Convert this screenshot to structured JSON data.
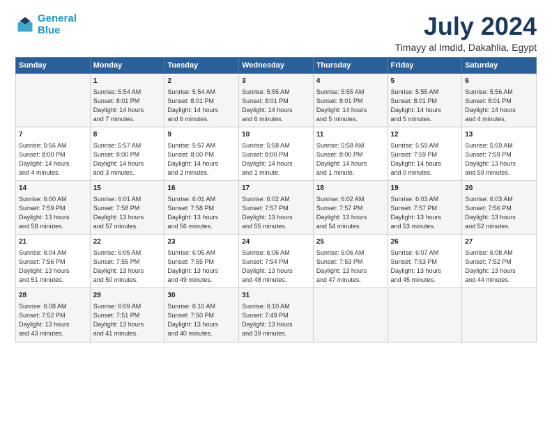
{
  "header": {
    "logo_line1": "General",
    "logo_line2": "Blue",
    "title": "July 2024",
    "subtitle": "Timayy al Imdid, Dakahlia, Egypt"
  },
  "days_of_week": [
    "Sunday",
    "Monday",
    "Tuesday",
    "Wednesday",
    "Thursday",
    "Friday",
    "Saturday"
  ],
  "weeks": [
    [
      {
        "day": "",
        "content": ""
      },
      {
        "day": "1",
        "content": "Sunrise: 5:54 AM\nSunset: 8:01 PM\nDaylight: 14 hours\nand 7 minutes."
      },
      {
        "day": "2",
        "content": "Sunrise: 5:54 AM\nSunset: 8:01 PM\nDaylight: 14 hours\nand 6 minutes."
      },
      {
        "day": "3",
        "content": "Sunrise: 5:55 AM\nSunset: 8:01 PM\nDaylight: 14 hours\nand 6 minutes."
      },
      {
        "day": "4",
        "content": "Sunrise: 5:55 AM\nSunset: 8:01 PM\nDaylight: 14 hours\nand 5 minutes."
      },
      {
        "day": "5",
        "content": "Sunrise: 5:55 AM\nSunset: 8:01 PM\nDaylight: 14 hours\nand 5 minutes."
      },
      {
        "day": "6",
        "content": "Sunrise: 5:56 AM\nSunset: 8:01 PM\nDaylight: 14 hours\nand 4 minutes."
      }
    ],
    [
      {
        "day": "7",
        "content": "Sunrise: 5:56 AM\nSunset: 8:00 PM\nDaylight: 14 hours\nand 4 minutes."
      },
      {
        "day": "8",
        "content": "Sunrise: 5:57 AM\nSunset: 8:00 PM\nDaylight: 14 hours\nand 3 minutes."
      },
      {
        "day": "9",
        "content": "Sunrise: 5:57 AM\nSunset: 8:00 PM\nDaylight: 14 hours\nand 2 minutes."
      },
      {
        "day": "10",
        "content": "Sunrise: 5:58 AM\nSunset: 8:00 PM\nDaylight: 14 hours\nand 1 minute."
      },
      {
        "day": "11",
        "content": "Sunrise: 5:58 AM\nSunset: 8:00 PM\nDaylight: 14 hours\nand 1 minute."
      },
      {
        "day": "12",
        "content": "Sunrise: 5:59 AM\nSunset: 7:59 PM\nDaylight: 14 hours\nand 0 minutes."
      },
      {
        "day": "13",
        "content": "Sunrise: 5:59 AM\nSunset: 7:59 PM\nDaylight: 13 hours\nand 59 minutes."
      }
    ],
    [
      {
        "day": "14",
        "content": "Sunrise: 6:00 AM\nSunset: 7:59 PM\nDaylight: 13 hours\nand 58 minutes."
      },
      {
        "day": "15",
        "content": "Sunrise: 6:01 AM\nSunset: 7:58 PM\nDaylight: 13 hours\nand 57 minutes."
      },
      {
        "day": "16",
        "content": "Sunrise: 6:01 AM\nSunset: 7:58 PM\nDaylight: 13 hours\nand 56 minutes."
      },
      {
        "day": "17",
        "content": "Sunrise: 6:02 AM\nSunset: 7:57 PM\nDaylight: 13 hours\nand 55 minutes."
      },
      {
        "day": "18",
        "content": "Sunrise: 6:02 AM\nSunset: 7:57 PM\nDaylight: 13 hours\nand 54 minutes."
      },
      {
        "day": "19",
        "content": "Sunrise: 6:03 AM\nSunset: 7:57 PM\nDaylight: 13 hours\nand 53 minutes."
      },
      {
        "day": "20",
        "content": "Sunrise: 6:03 AM\nSunset: 7:56 PM\nDaylight: 13 hours\nand 52 minutes."
      }
    ],
    [
      {
        "day": "21",
        "content": "Sunrise: 6:04 AM\nSunset: 7:56 PM\nDaylight: 13 hours\nand 51 minutes."
      },
      {
        "day": "22",
        "content": "Sunrise: 6:05 AM\nSunset: 7:55 PM\nDaylight: 13 hours\nand 50 minutes."
      },
      {
        "day": "23",
        "content": "Sunrise: 6:05 AM\nSunset: 7:55 PM\nDaylight: 13 hours\nand 49 minutes."
      },
      {
        "day": "24",
        "content": "Sunrise: 6:06 AM\nSunset: 7:54 PM\nDaylight: 13 hours\nand 48 minutes."
      },
      {
        "day": "25",
        "content": "Sunrise: 6:06 AM\nSunset: 7:53 PM\nDaylight: 13 hours\nand 47 minutes."
      },
      {
        "day": "26",
        "content": "Sunrise: 6:07 AM\nSunset: 7:53 PM\nDaylight: 13 hours\nand 45 minutes."
      },
      {
        "day": "27",
        "content": "Sunrise: 6:08 AM\nSunset: 7:52 PM\nDaylight: 13 hours\nand 44 minutes."
      }
    ],
    [
      {
        "day": "28",
        "content": "Sunrise: 6:08 AM\nSunset: 7:52 PM\nDaylight: 13 hours\nand 43 minutes."
      },
      {
        "day": "29",
        "content": "Sunrise: 6:09 AM\nSunset: 7:51 PM\nDaylight: 13 hours\nand 41 minutes."
      },
      {
        "day": "30",
        "content": "Sunrise: 6:10 AM\nSunset: 7:50 PM\nDaylight: 13 hours\nand 40 minutes."
      },
      {
        "day": "31",
        "content": "Sunrise: 6:10 AM\nSunset: 7:49 PM\nDaylight: 13 hours\nand 39 minutes."
      },
      {
        "day": "",
        "content": ""
      },
      {
        "day": "",
        "content": ""
      },
      {
        "day": "",
        "content": ""
      }
    ]
  ]
}
